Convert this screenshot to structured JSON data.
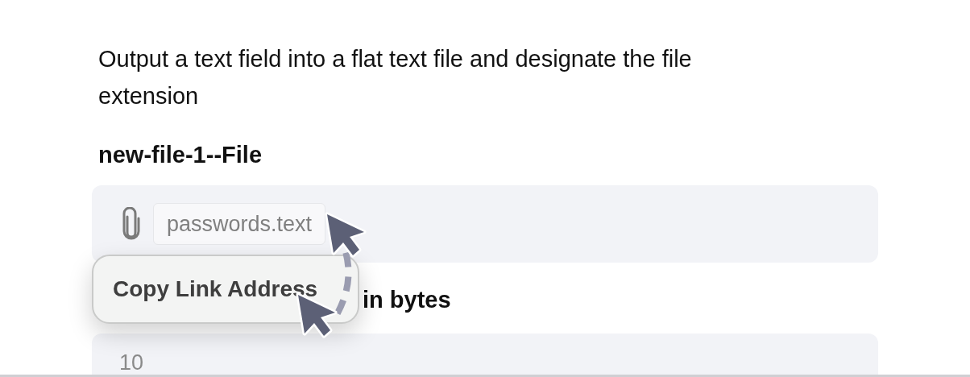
{
  "description": "Output a text field into a flat text file and designate the file extension",
  "file_field": {
    "label": "new-file-1--File",
    "attachment": "passwords.text"
  },
  "size_field": {
    "label": "in bytes",
    "value": "10"
  },
  "context_menu": {
    "items": [
      {
        "label": "Copy Link Address"
      }
    ]
  }
}
